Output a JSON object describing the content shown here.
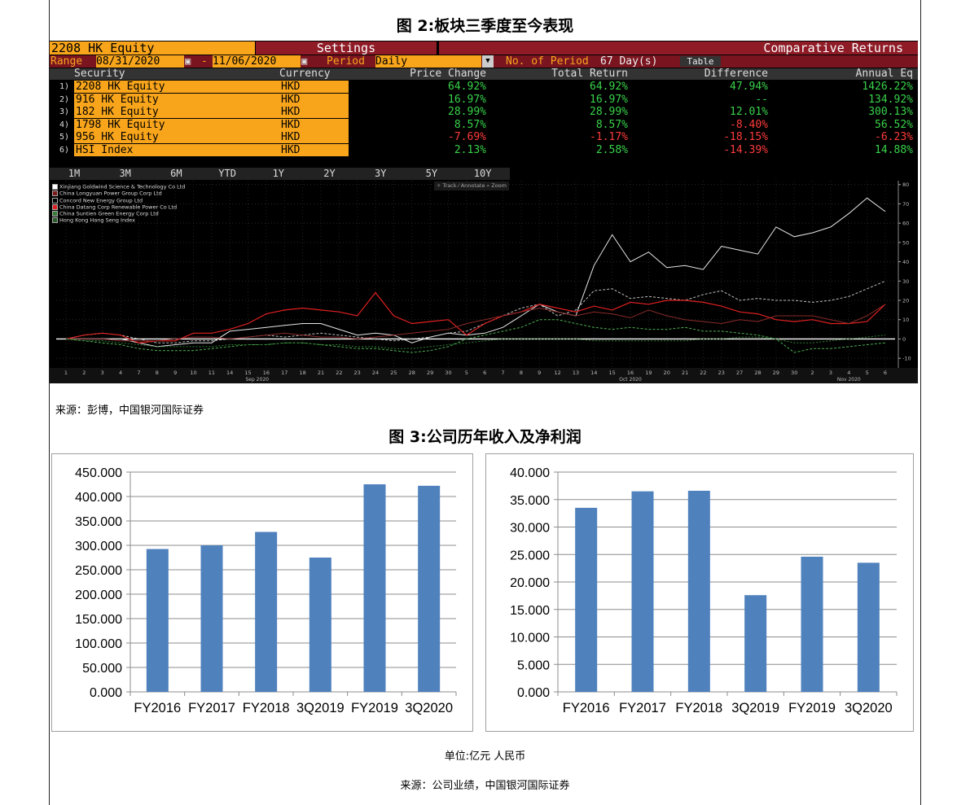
{
  "fig2": {
    "title": "图 2:板块三季度至今表现",
    "source": "来源：彭博，中国银河国际证券",
    "security_header": "2208 HK Equity",
    "settings_label": "Settings",
    "comparative_label": "Comparative Returns",
    "range_label": "Range",
    "range_from": "08/31/2020",
    "range_dash": "-",
    "range_to": "11/06/2020",
    "period_label": "Period",
    "period_value": "Daily",
    "num_period_label": "No. of Period",
    "num_period_value": "67 Day(s)",
    "table_button": "Table",
    "columns": [
      "Security",
      "Currency",
      "Price Change",
      "Total Return",
      "Difference",
      "Annual Eq"
    ],
    "rows": [
      {
        "idx": "1)",
        "security": "2208 HK Equity",
        "currency": "HKD",
        "price_change": "64.92%",
        "total_return": "64.92%",
        "difference": "47.94%",
        "annual_eq": "1426.22%"
      },
      {
        "idx": "2)",
        "security": "916 HK Equity",
        "currency": "HKD",
        "price_change": "16.97%",
        "total_return": "16.97%",
        "difference": "--",
        "annual_eq": "134.92%"
      },
      {
        "idx": "3)",
        "security": "182 HK Equity",
        "currency": "HKD",
        "price_change": "28.99%",
        "total_return": "28.99%",
        "difference": "12.01%",
        "annual_eq": "300.13%"
      },
      {
        "idx": "4)",
        "security": "1798 HK Equity",
        "currency": "HKD",
        "price_change": "8.57%",
        "total_return": "8.57%",
        "difference": "-8.40%",
        "annual_eq": "56.52%"
      },
      {
        "idx": "5)",
        "security": "956 HK Equity",
        "currency": "HKD",
        "price_change": "-7.69%",
        "total_return": "-1.17%",
        "difference": "-18.15%",
        "annual_eq": "-6.23%"
      },
      {
        "idx": "6)",
        "security": "HSI Index",
        "currency": "HKD",
        "price_change": "2.13%",
        "total_return": "2.58%",
        "difference": "-14.39%",
        "annual_eq": "14.88%"
      }
    ],
    "tabs": [
      "1M",
      "3M",
      "6M",
      "YTD",
      "1Y",
      "2Y",
      "3Y",
      "5Y",
      "10Y"
    ],
    "tools": "✧ Track  ⁄ Annotate  ⌕ Zoom",
    "legend": [
      {
        "name": "Xinjiang Goldwind Science & Technology Co Ltd",
        "color": "#ffffff"
      },
      {
        "name": "China Longyuan Power Group Corp Ltd",
        "color": "#7a1a1a"
      },
      {
        "name": "Concord New Energy Group Ltd",
        "color": "#000000"
      },
      {
        "name": "China Datang Corp Renewable Power Co Ltd",
        "color": "#e02020"
      },
      {
        "name": "China Suntien Green Energy Corp Ltd",
        "color": "#3a7a3a"
      },
      {
        "name": "Hong Kong Hang Seng Index",
        "color": "#2a5a2a"
      }
    ],
    "x_tick_labels": [
      "1",
      "2",
      "3",
      "4",
      "7",
      "8",
      "9",
      "10",
      "11",
      "14",
      "15",
      "16",
      "17",
      "18",
      "21",
      "22",
      "23",
      "24",
      "25",
      "28",
      "29",
      "30",
      "5",
      "6",
      "7",
      "8",
      "9",
      "12",
      "13",
      "14",
      "15",
      "16",
      "19",
      "20",
      "21",
      "22",
      "23",
      "27",
      "28",
      "29",
      "30",
      "2",
      "3",
      "4",
      "5",
      "6"
    ],
    "month_labels": [
      "Sep 2020",
      "Oct 2020",
      "Nov 2020"
    ],
    "y_ticks": [
      80,
      70,
      60,
      50,
      40,
      30,
      20,
      10,
      0,
      -10
    ],
    "series": [
      {
        "name": "Xinjiang Goldwind Science & Technology Co Ltd",
        "color": "#e6e6e6",
        "width": 1,
        "values": [
          0,
          0,
          0,
          0,
          -2,
          -4,
          -3,
          -2,
          -2,
          4,
          5,
          6,
          7,
          8,
          8,
          5,
          2,
          3,
          2,
          -2,
          1,
          3,
          2,
          3,
          6,
          12,
          18,
          14,
          12,
          38,
          54,
          40,
          45,
          37,
          38,
          36,
          48,
          46,
          44,
          58,
          53,
          55,
          58,
          65,
          73,
          66
        ]
      },
      {
        "name": "Concord New Energy Group Ltd",
        "color": "#bdbdbd",
        "width": 1,
        "dash": "3,2",
        "values": [
          0,
          2,
          3,
          2,
          0,
          -2,
          -2,
          -1,
          -1,
          0,
          1,
          2,
          1,
          2,
          3,
          2,
          1,
          0,
          -1,
          0,
          1,
          3,
          4,
          8,
          12,
          16,
          18,
          12,
          15,
          25,
          26,
          21,
          22,
          21,
          20,
          23,
          25,
          20,
          21,
          20,
          20,
          19,
          20,
          22,
          26,
          30
        ]
      },
      {
        "name": "China Datang Corp Renewable Power Co Ltd",
        "color": "#e02020",
        "width": 1.2,
        "values": [
          0,
          2,
          3,
          2,
          -2,
          -1,
          -1,
          3,
          3,
          5,
          8,
          13,
          15,
          16,
          15,
          14,
          12,
          24,
          12,
          8,
          9,
          10,
          2,
          8,
          12,
          14,
          18,
          16,
          14,
          17,
          15,
          19,
          18,
          20,
          20,
          19,
          17,
          14,
          13,
          10,
          9,
          10,
          8,
          8,
          9,
          18
        ]
      },
      {
        "name": "China Longyuan Power Group Corp Ltd",
        "color": "#8a2a2a",
        "width": 1,
        "values": [
          0,
          0,
          0,
          -1,
          -1,
          -1,
          0,
          1,
          1,
          0,
          1,
          2,
          3,
          2,
          1,
          1,
          0,
          1,
          2,
          3,
          4,
          5,
          8,
          10,
          12,
          14,
          16,
          14,
          12,
          14,
          13,
          11,
          15,
          12,
          10,
          9,
          8,
          10,
          9,
          12,
          12,
          12,
          10,
          8,
          12,
          18
        ]
      },
      {
        "name": "China Suntien Green Energy Corp Ltd",
        "color": "#4caf50",
        "width": 1,
        "dash": "3,2",
        "values": [
          0,
          -1,
          -2,
          -3,
          -5,
          -6,
          -6,
          -6,
          -5,
          -4,
          -3,
          -3,
          -2,
          -2,
          -3,
          -4,
          -5,
          -5,
          -6,
          -7,
          -6,
          -4,
          0,
          2,
          4,
          6,
          10,
          10,
          8,
          6,
          5,
          6,
          5,
          5,
          6,
          4,
          4,
          3,
          2,
          0,
          -7,
          -5,
          -5,
          -4,
          -3,
          -2
        ]
      },
      {
        "name": "Hong Kong Hang Seng Index",
        "color": "#2e7d32",
        "width": 1,
        "dash": "2,2",
        "values": [
          0,
          -1,
          -1,
          -2,
          -3,
          -4,
          -4,
          -4,
          -4,
          -3,
          -3,
          -3,
          -2,
          -2,
          -3,
          -3,
          -4,
          -4,
          -5,
          -5,
          -4,
          -3,
          -2,
          -1,
          0,
          0,
          0,
          0,
          0,
          -1,
          -1,
          -1,
          -1,
          -1,
          -1,
          0,
          0,
          1,
          1,
          0,
          -2,
          -2,
          -1,
          0,
          1,
          2
        ]
      }
    ]
  },
  "fig3": {
    "title": "图 3:公司历年收入及净利润",
    "unit_note": "单位:亿元  人民币",
    "source": "来源：公司业绩，中国银河国际证券"
  },
  "chart_data": [
    {
      "type": "bar",
      "title": "",
      "categories": [
        "FY2016",
        "FY2017",
        "FY2018",
        "3Q2019",
        "FY2019",
        "3Q2020"
      ],
      "values": [
        292.5,
        300.0,
        327.5,
        275.0,
        425.0,
        422.0
      ],
      "ylim": [
        0,
        450
      ],
      "yticks": [
        "450.000",
        "400.000",
        "350.000",
        "300.000",
        "250.000",
        "200.000",
        "150.000",
        "100.000",
        "50.000",
        "0.000"
      ],
      "grid": true,
      "bar_color": "#4f81bd"
    },
    {
      "type": "bar",
      "title": "",
      "categories": [
        "FY2016",
        "FY2017",
        "FY2018",
        "3Q2019",
        "FY2019",
        "3Q2020"
      ],
      "values": [
        33.5,
        36.5,
        36.6,
        17.6,
        24.6,
        23.5
      ],
      "ylim": [
        0,
        40
      ],
      "yticks": [
        "40.000",
        "35.000",
        "30.000",
        "25.000",
        "20.000",
        "15.000",
        "10.000",
        "5.000",
        "0.000"
      ],
      "grid": true,
      "bar_color": "#4f81bd"
    }
  ]
}
